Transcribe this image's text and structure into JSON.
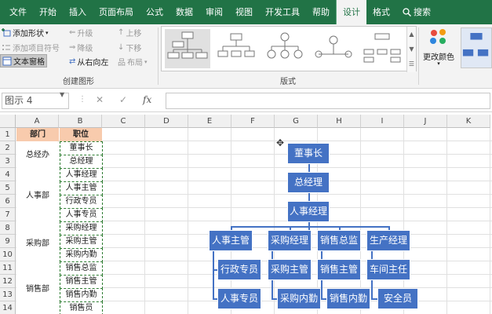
{
  "ribbon": {
    "tabs": [
      "文件",
      "开始",
      "插入",
      "页面布局",
      "公式",
      "数据",
      "审阅",
      "视图",
      "开发工具",
      "帮助",
      "设计",
      "格式"
    ],
    "active_tab": "设计",
    "search_label": "搜索",
    "create_group": {
      "add_shape": "添加形状",
      "add_bullet": "添加项目符号",
      "text_pane": "文本窗格",
      "promote": "升级",
      "demote": "降级",
      "right_to_left": "从右向左",
      "move_up": "上移",
      "move_down": "下移",
      "layout": "布局",
      "label": "创建图形"
    },
    "layouts_group": {
      "label": "版式"
    },
    "change_colors": "更改颜色"
  },
  "formula_bar": {
    "name_box": "图示 4",
    "cancel_symbol": "✕",
    "enter_symbol": "✓",
    "fx_symbol": "fx",
    "formula": ""
  },
  "grid": {
    "columns": [
      "A",
      "B",
      "C",
      "D",
      "E",
      "F",
      "G",
      "H",
      "I",
      "J",
      "K"
    ],
    "rows": [
      "1",
      "2",
      "3",
      "4",
      "5",
      "6",
      "7",
      "8",
      "9",
      "10",
      "11",
      "12",
      "13",
      "14"
    ],
    "header_A": "部门",
    "header_B": "职位",
    "departments": [
      "总经办",
      "人事部",
      "采购部",
      "销售部"
    ],
    "positions": [
      "董事长",
      "总经理",
      "人事经理",
      "人事主管",
      "行政专员",
      "人事专员",
      "采购经理",
      "采购主管",
      "采购内勤",
      "销售总监",
      "销售主管",
      "销售内勤",
      "销售员"
    ]
  },
  "org_chart": {
    "chairman": "董事长",
    "gm": "总经理",
    "hr_manager": "人事经理",
    "hr_supervisor": "人事主管",
    "purchase_manager": "采购经理",
    "sales_director": "销售总监",
    "production_manager": "生产经理",
    "admin_specialist": "行政专员",
    "purchase_supervisor": "采购主管",
    "sales_supervisor": "销售主管",
    "workshop_director": "车间主任",
    "hr_specialist": "人事专员",
    "purchase_clerk": "采购内勤",
    "sales_clerk": "销售内勤",
    "safety_officer": "安全员"
  }
}
